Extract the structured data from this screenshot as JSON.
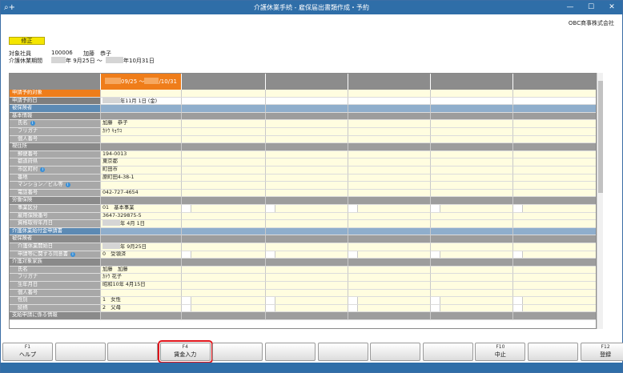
{
  "window": {
    "title": "介護休業手続 - 雇保届出書類作成・予約",
    "app_icon": "⌕+",
    "minimize": "—",
    "maximize": "☐",
    "close": "✕"
  },
  "company": "OBC商事株式会社",
  "mode_badge": "修正",
  "employee": {
    "label": "対象社員",
    "code": "100006",
    "name": "加藤　恭子"
  },
  "leave_period": {
    "label": "介護休業期間",
    "start_suffix": "年 9月25日 ～",
    "end_suffix": "年10月31日"
  },
  "grid": {
    "active_column": {
      "prefix": "09/25 ～",
      "suffix": "/10/31"
    },
    "rows": [
      {
        "label": "申請予約対象",
        "kind": "orange",
        "value": ""
      },
      {
        "label": "申請予約日",
        "kind": "white",
        "value": "年11月 1日 (金)",
        "redact": true
      },
      {
        "label": "被保険者",
        "kind": "section",
        "value": ""
      },
      {
        "label": "基本情報",
        "kind": "group",
        "value": ""
      },
      {
        "label": "氏名",
        "kind": "sub",
        "value": "加藤　恭子",
        "info": true
      },
      {
        "label": "フリガナ",
        "kind": "sub",
        "value": "ｶﾄｳ ｷｮｳｺ"
      },
      {
        "label": "個人番号",
        "kind": "sub",
        "value": ""
      },
      {
        "label": "現住所",
        "kind": "group",
        "value": ""
      },
      {
        "label": "郵便番号",
        "kind": "sub",
        "value": "194-0013"
      },
      {
        "label": "都道府県",
        "kind": "sub",
        "value": "東京都"
      },
      {
        "label": "市区町村",
        "kind": "sub",
        "value": "町田市",
        "info": true
      },
      {
        "label": "番地",
        "kind": "sub",
        "value": "原町田4-38-1"
      },
      {
        "label": "マンション／ビル等",
        "kind": "sub",
        "value": "",
        "info": true
      },
      {
        "label": "電話番号",
        "kind": "sub",
        "value": "042-727-4654"
      },
      {
        "label": "労働保険",
        "kind": "group",
        "value": ""
      },
      {
        "label": "事業区分",
        "kind": "sub",
        "value": "01　基本事業",
        "boxes": true
      },
      {
        "label": "雇用保険番号",
        "kind": "sub",
        "value": "3647-329875-5"
      },
      {
        "label": "資格取得年月日",
        "kind": "sub",
        "value": "年 4月 1日",
        "redact": true
      },
      {
        "label": "介護休業給付金申請書",
        "kind": "section",
        "value": ""
      },
      {
        "label": "被保険者",
        "kind": "group",
        "value": ""
      },
      {
        "label": "介護休業開始日",
        "kind": "sub",
        "value": "年 9月25日",
        "redact": true
      },
      {
        "label": "申請等に関する同意書",
        "kind": "sub",
        "value": "0　受領済",
        "info": true,
        "boxes": true
      },
      {
        "label": "介護対象家族",
        "kind": "group",
        "value": ""
      },
      {
        "label": "氏名",
        "kind": "sub",
        "value": "加藤　加藤"
      },
      {
        "label": "フリガナ",
        "kind": "sub",
        "value": "ｶﾄｳ 花子"
      },
      {
        "label": "生年月日",
        "kind": "sub",
        "value": "昭和10年 4月15日"
      },
      {
        "label": "個人番号",
        "kind": "sub",
        "value": ""
      },
      {
        "label": "性別",
        "kind": "sub",
        "value": "1　女性",
        "boxes": true
      },
      {
        "label": "続柄",
        "kind": "sub",
        "value": "2　父母",
        "boxes": true
      },
      {
        "label": "支給申請に係る情報",
        "kind": "group",
        "value": ""
      }
    ]
  },
  "function_keys": [
    {
      "code": "F1",
      "label": "ヘルプ"
    },
    {
      "code": "",
      "label": ""
    },
    {
      "code": "",
      "label": ""
    },
    {
      "code": "F4",
      "label": "賃金入力",
      "highlight": true
    },
    {
      "code": "",
      "label": ""
    },
    {
      "code": "",
      "label": ""
    },
    {
      "code": "",
      "label": ""
    },
    {
      "code": "",
      "label": ""
    },
    {
      "code": "",
      "label": ""
    },
    {
      "code": "F10",
      "label": "中止"
    },
    {
      "code": "",
      "label": ""
    },
    {
      "code": "F12",
      "label": "登録"
    }
  ],
  "colors": {
    "title_bar": "#2f6ea8",
    "active_column": "#ef7d1a",
    "highlight_ring": "#e0151b",
    "badge": "#f5e600"
  }
}
